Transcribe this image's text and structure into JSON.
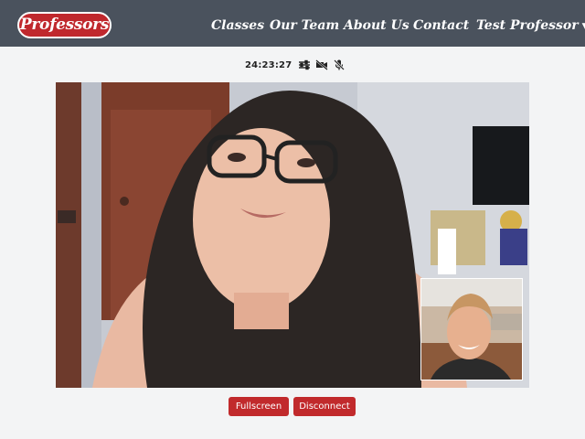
{
  "navbar": {
    "brand": "Professors",
    "links": [
      {
        "label": "Classes"
      },
      {
        "label": "Our Team"
      },
      {
        "label": "About Us"
      },
      {
        "label": "Contact"
      }
    ],
    "user_menu": {
      "label": "Test Professor",
      "icon": "caret-down-icon"
    }
  },
  "call": {
    "timer": "24:23:27",
    "icons": [
      "settings-sliders-icon",
      "camera-off-icon",
      "mic-off-icon"
    ]
  },
  "actions": {
    "fullscreen_label": "Fullscreen",
    "disconnect_label": "Disconnect"
  },
  "colors": {
    "navbar_bg": "#4a525d",
    "brand_bg": "#c0282d",
    "button_bg": "#c12a2c",
    "page_bg": "#f3f4f5"
  }
}
